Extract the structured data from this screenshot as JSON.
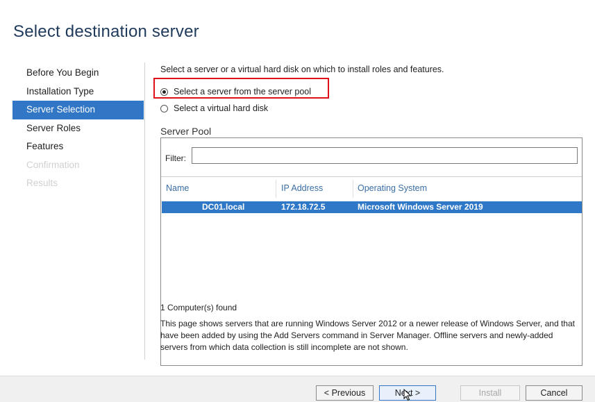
{
  "page": {
    "title": "Select destination server"
  },
  "nav": {
    "items": [
      {
        "label": "Before You Begin",
        "state": "normal"
      },
      {
        "label": "Installation Type",
        "state": "normal"
      },
      {
        "label": "Server Selection",
        "state": "active"
      },
      {
        "label": "Server Roles",
        "state": "normal"
      },
      {
        "label": "Features",
        "state": "normal"
      },
      {
        "label": "Confirmation",
        "state": "disabled"
      },
      {
        "label": "Results",
        "state": "disabled"
      }
    ]
  },
  "main": {
    "instruction": "Select a server or a virtual hard disk on which to install roles and features.",
    "options": [
      {
        "label": "Select a server from the server pool",
        "checked": true
      },
      {
        "label": "Select a virtual hard disk",
        "checked": false
      }
    ],
    "pool": {
      "title": "Server Pool",
      "filter_label": "Filter:",
      "filter_value": "",
      "columns": [
        "Name",
        "IP Address",
        "Operating System"
      ],
      "rows": [
        {
          "name": "DC01.local",
          "ip": "172.18.72.5",
          "os": "Microsoft Windows Server 2019",
          "selected": true
        }
      ]
    },
    "count_text": "1 Computer(s) found",
    "description": "This page shows servers that are running Windows Server 2012 or a newer release of Windows Server, and that have been added by using the Add Servers command in Server Manager. Offline servers and newly-added servers from which data collection is still incomplete are not shown."
  },
  "footer": {
    "previous": "< Previous",
    "next": "Next >",
    "install": "Install",
    "cancel": "Cancel"
  },
  "colors": {
    "accent": "#3277c5",
    "selection": "#2f78c8",
    "highlight": "#e0101a",
    "title": "#1f3a5a"
  }
}
